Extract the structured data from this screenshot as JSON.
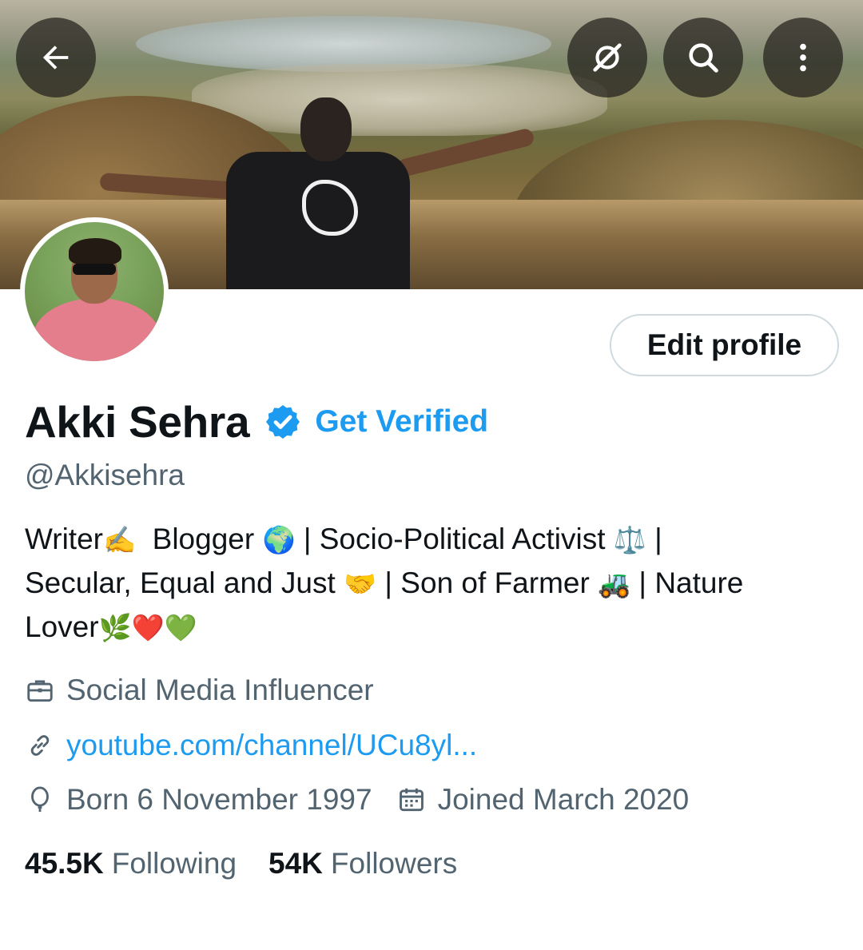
{
  "header": {
    "back_icon": "back-arrow-icon",
    "grok_icon": "grok-slash-icon",
    "search_icon": "search-icon",
    "more_icon": "more-vertical-icon"
  },
  "profile": {
    "display_name": "Akki Sehra",
    "verified_badge": "verified-badge-icon",
    "get_verified_label": "Get Verified",
    "handle": "@Akkisehra",
    "edit_profile_label": "Edit profile",
    "bio_lines": [
      {
        "parts": [
          "Writer",
          "✍️",
          "  Blogger ",
          "🌍",
          " | Socio-Political Activist ",
          "⚖️",
          " |"
        ]
      },
      {
        "parts": [
          "Secular, Equal and Just ",
          "🤝",
          " | Son of Farmer ",
          "🚜",
          " | Nature"
        ]
      },
      {
        "parts": [
          "Lover",
          "🌿",
          "❤️",
          "💚"
        ]
      }
    ],
    "category": "Social Media Influencer",
    "website": "youtube.com/channel/UCu8yl...",
    "birthday": "Born 6 November 1997",
    "joined": "Joined March 2020"
  },
  "stats": {
    "following_count": "45.5K",
    "following_label": "Following",
    "followers_count": "54K",
    "followers_label": "Followers"
  },
  "colors": {
    "accent": "#1d9bf0",
    "secondary_text": "#536471",
    "primary_text": "#0f1419",
    "border": "#cfd9de"
  }
}
